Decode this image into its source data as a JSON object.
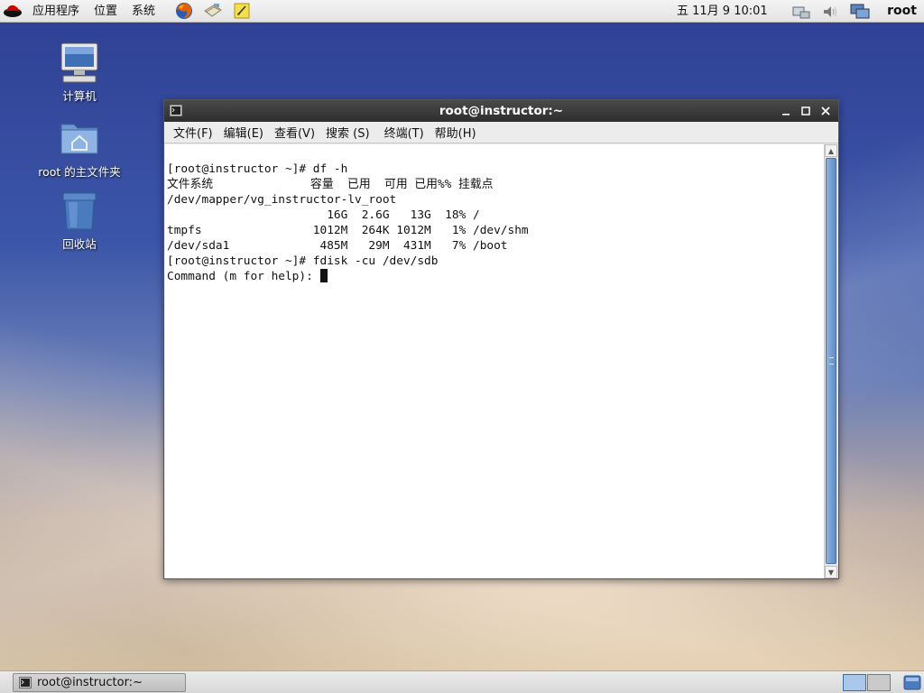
{
  "top_panel": {
    "menus": [
      "应用程序",
      "位置",
      "系统"
    ],
    "launchers": [
      "firefox-icon",
      "mail-icon",
      "notes-icon"
    ],
    "clock": "五 11月  9 10:01",
    "tray": [
      "network-icon",
      "volume-icon",
      "display-icon"
    ],
    "user": "root"
  },
  "desktop_icons": [
    {
      "name": "computer-icon",
      "label": "计算机"
    },
    {
      "name": "home-folder-icon",
      "label": "root 的主文件夹"
    },
    {
      "name": "trash-icon",
      "label": "回收站"
    }
  ],
  "terminal": {
    "title": "root@instructor:~",
    "menus": [
      "文件(F)",
      "编辑(E)",
      "查看(V)",
      "搜索 (S)",
      "终端(T)",
      "帮助(H)"
    ],
    "lines": [
      "[root@instructor ~]# df -h",
      "文件系统              容量  已用  可用 已用%% 挂载点",
      "/dev/mapper/vg_instructor-lv_root",
      "                       16G  2.6G   13G  18% /",
      "tmpfs                1012M  264K 1012M   1% /dev/shm",
      "/dev/sda1             485M   29M  431M   7% /boot",
      "[root@instructor ~]# fdisk -cu /dev/sdb",
      "",
      "Command (m for help): "
    ]
  },
  "taskbar": {
    "task_label": "root@instructor:~"
  },
  "colors": {
    "titlebar": "#3a3a3a",
    "scroll_thumb": "#6f98cf",
    "workspace_active": "#a9c7ea"
  }
}
